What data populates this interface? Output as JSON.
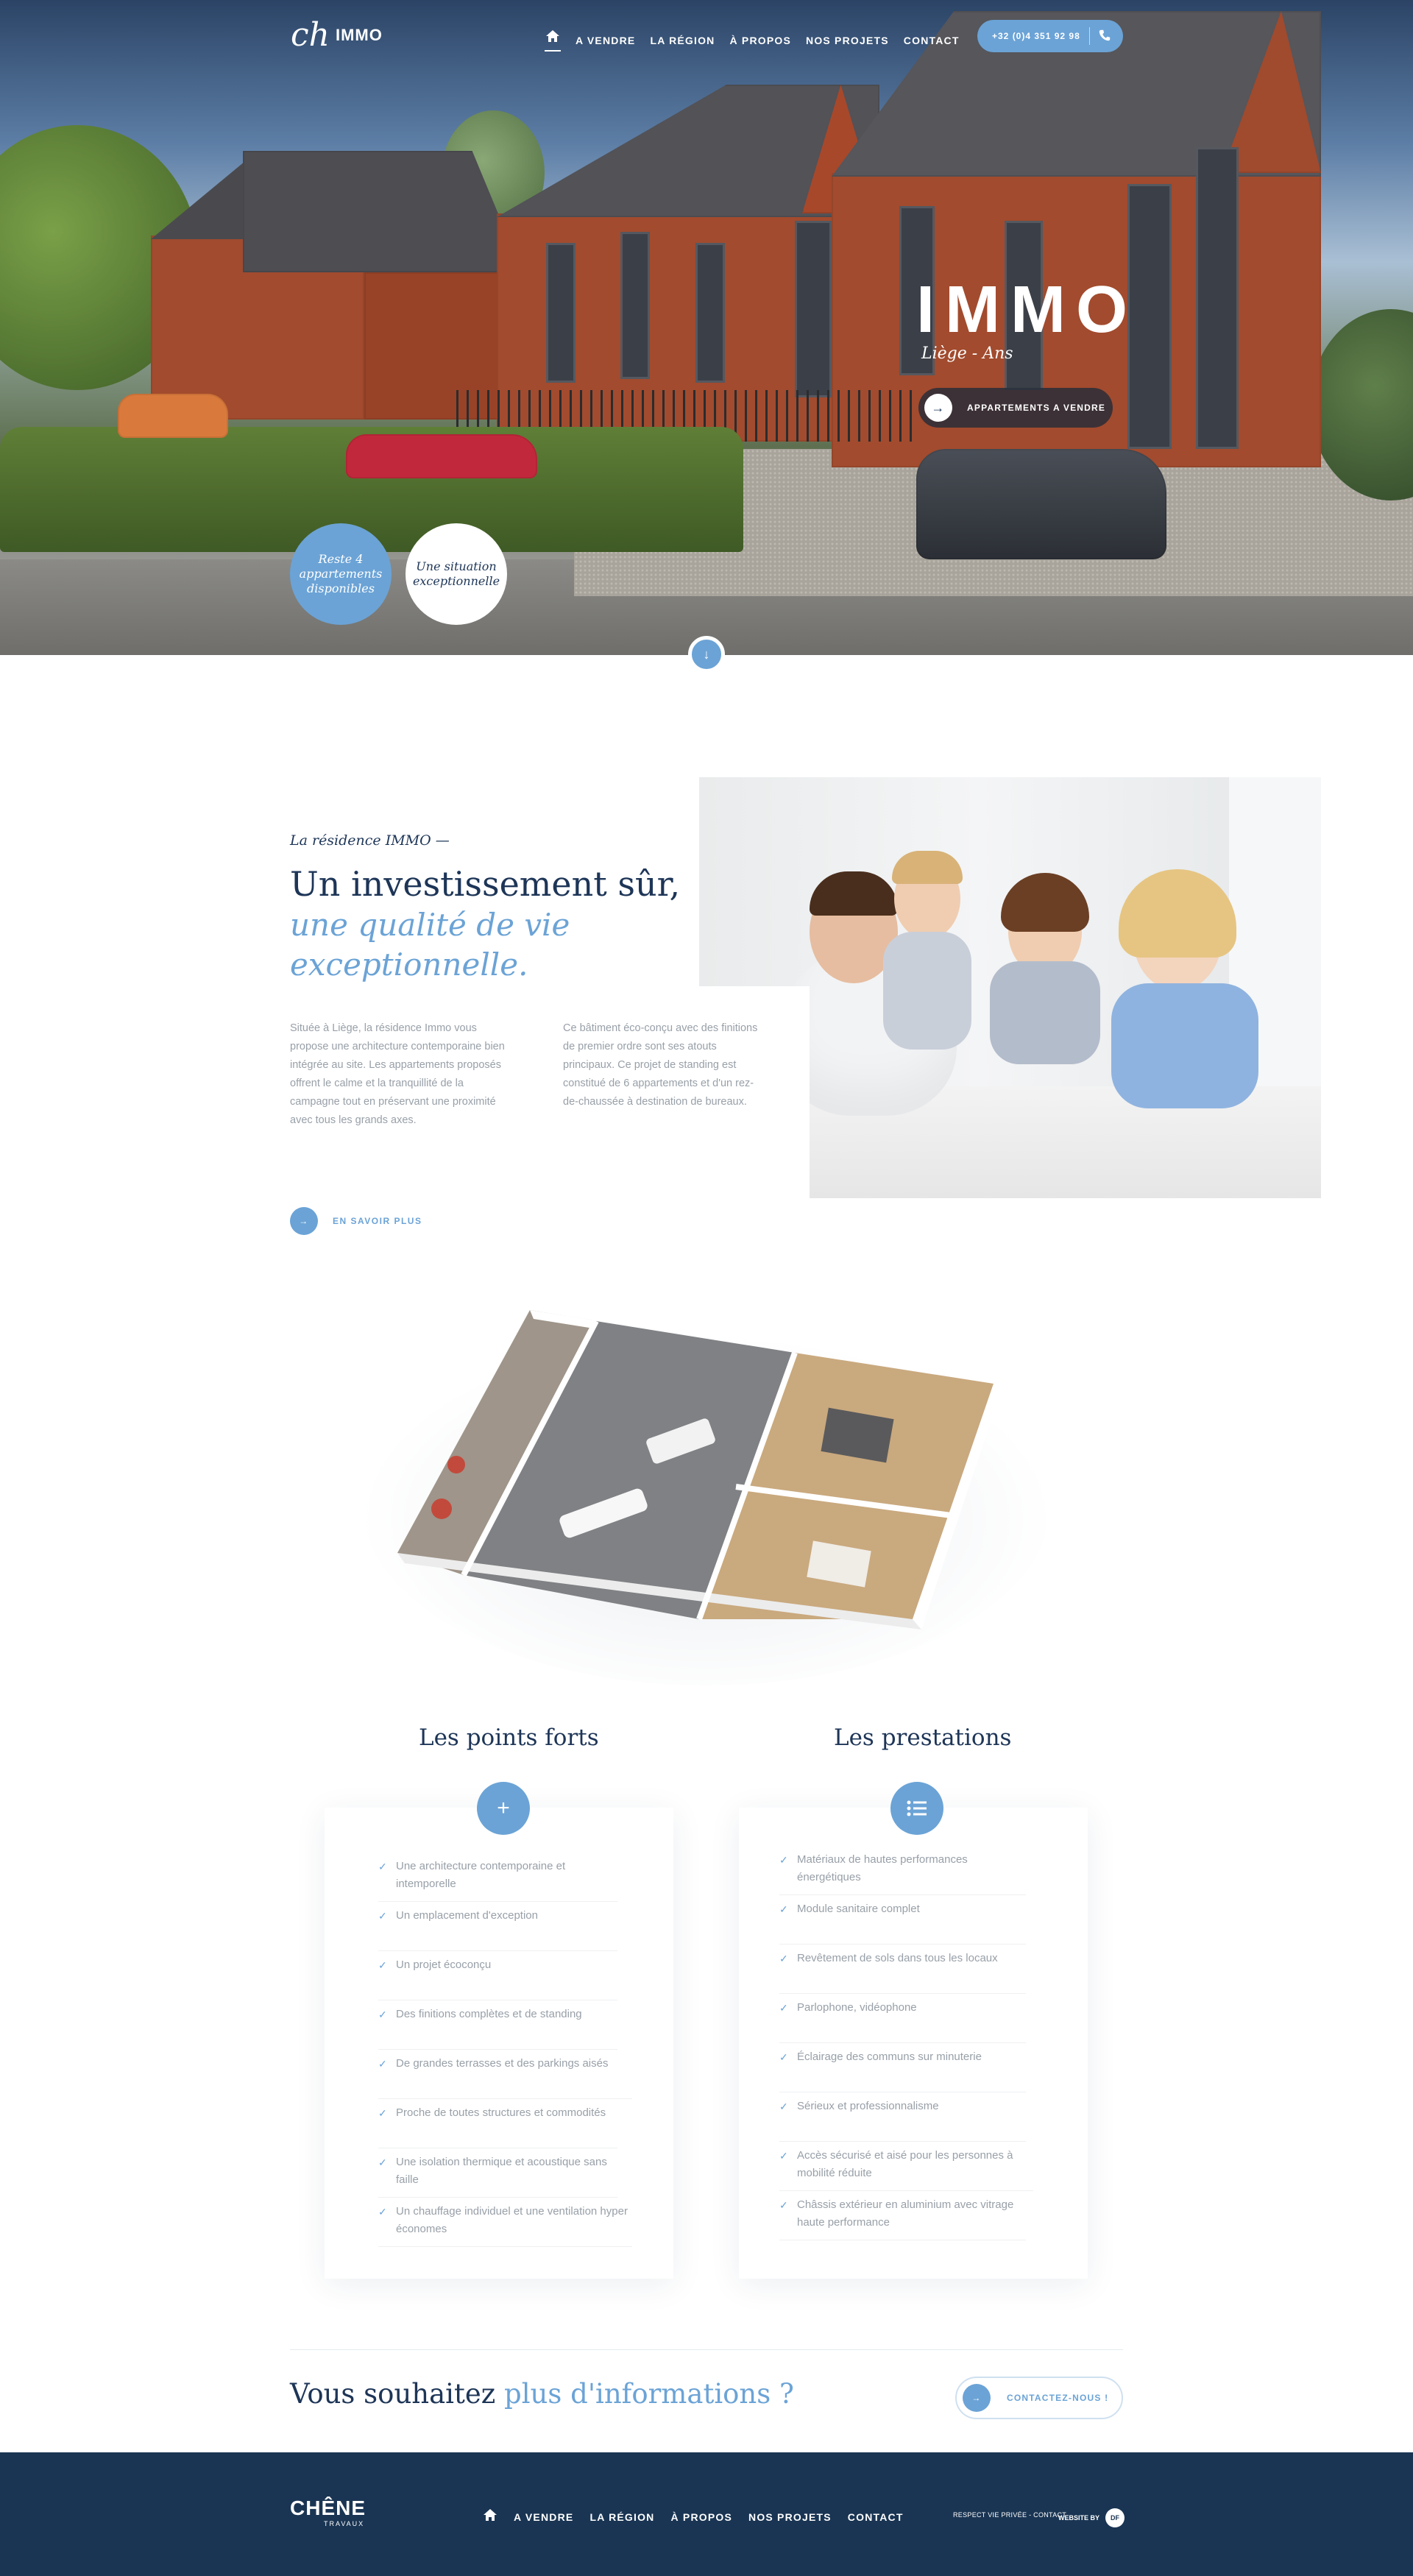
{
  "brand": {
    "logo_mark": "ch",
    "logo_word": "IMMO"
  },
  "nav": {
    "items": [
      "A VENDRE",
      "LA RÉGION",
      "À PROPOS",
      "NOS PROJETS",
      "CONTACT"
    ],
    "phone": "+32 (0)4 351 92 98"
  },
  "hero": {
    "title": "IMMO",
    "subtitle": "Liège - Ans",
    "cta": "APPARTEMENTS A VENDRE",
    "badge_available": "Reste 4 appartements disponibles",
    "badge_location": "Une situation exceptionnelle"
  },
  "intro": {
    "kicker": "La résidence IMMO —",
    "heading": "Un investissement sûr,",
    "heading_accent": "une qualité de vie exceptionnelle.",
    "para_left": "Située à Liège, la résidence Immo vous propose une architecture contemporaine bien intégrée au site. Les appartements proposés offrent le calme et la tranquillité de la campagne tout en préservant une proximité avec tous les grands axes.",
    "para_right": "Ce bâtiment éco-conçu avec des finitions de premier ordre sont ses atouts principaux. Ce projet de standing est constitué de 6 appartements et d'un rez-de-chaussée à destination de bureaux.",
    "more": "EN SAVOIR PLUS"
  },
  "strengths": {
    "title": "Les points forts",
    "items": [
      "Une architecture contemporaine et intemporelle",
      "Un emplacement d'exception",
      "Un projet écoconçu",
      "Des finitions complètes et de standing",
      "De grandes terrasses et des parkings aisés",
      "Proche de toutes structures et commodités",
      "Une isolation thermique et acoustique sans faille",
      "Un chauffage individuel et une ventilation hyper économes"
    ]
  },
  "services": {
    "title": "Les prestations",
    "items": [
      "Matériaux de hautes performances énergétiques",
      "Module sanitaire complet",
      "Revêtement de sols dans tous les locaux",
      "Parlophone, vidéophone",
      "Éclairage des communs sur minuterie",
      "Sérieux et professionnalisme",
      "Accès sécurisé et aisé pour les personnes à mobilité réduite",
      "Châssis extérieur en aluminium avec vitrage haute performance"
    ]
  },
  "cta": {
    "text": "Vous souhaitez",
    "accent": "plus d'informations ?",
    "button": "CONTACTEZ-NOUS !"
  },
  "footer": {
    "logo": "CHÊNE",
    "logo_sub": "TRAVAUX",
    "nav": [
      "A VENDRE",
      "LA RÉGION",
      "À PROPOS",
      "NOS PROJETS",
      "CONTACT"
    ],
    "legal": "RESPECT VIE PRIVÉE - CONTACT",
    "credit": "WEBSITE BY",
    "credit_mark": "DF"
  },
  "colors": {
    "accent": "#6ba3d6",
    "navy": "#1d3557",
    "footer": "#1a3553"
  }
}
